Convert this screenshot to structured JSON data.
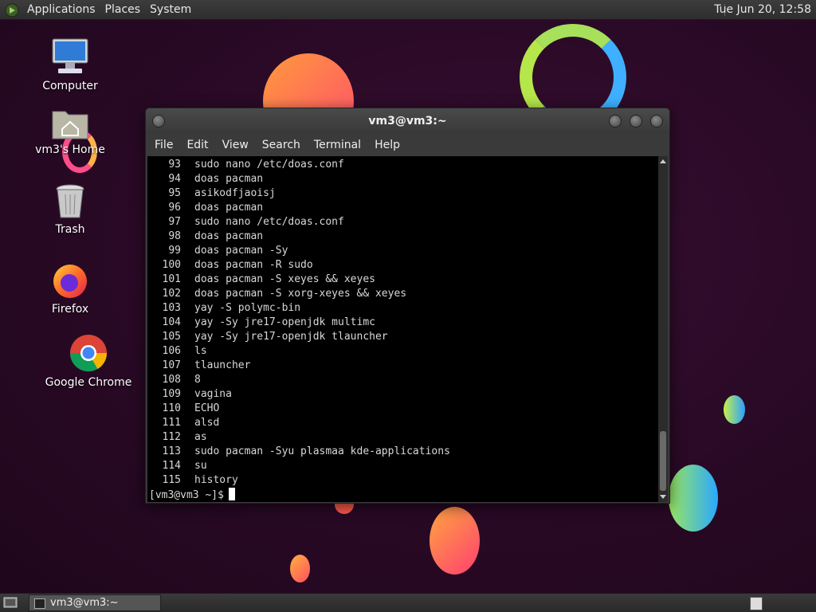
{
  "top_panel": {
    "menus": [
      "Applications",
      "Places",
      "System"
    ],
    "clock": "Tue Jun 20, 12:58"
  },
  "desktop_icons": [
    {
      "label": "Computer",
      "icon": "computer-icon"
    },
    {
      "label": "vm3's Home",
      "icon": "home-folder-icon"
    },
    {
      "label": "Trash",
      "icon": "trash-icon"
    },
    {
      "label": "Firefox",
      "icon": "firefox-icon"
    },
    {
      "label": "Google Chrome",
      "icon": "chrome-icon"
    }
  ],
  "terminal": {
    "title": "vm3@vm3:~",
    "menu": [
      "File",
      "Edit",
      "View",
      "Search",
      "Terminal",
      "Help"
    ],
    "history": [
      {
        "num": "93",
        "cmd": "sudo nano /etc/doas.conf"
      },
      {
        "num": "94",
        "cmd": "doas pacman"
      },
      {
        "num": "95",
        "cmd": "asikodfjaoisj"
      },
      {
        "num": "96",
        "cmd": "doas pacman"
      },
      {
        "num": "97",
        "cmd": "sudo nano /etc/doas.conf"
      },
      {
        "num": "98",
        "cmd": "doas pacman"
      },
      {
        "num": "99",
        "cmd": "doas pacman -Sy"
      },
      {
        "num": "100",
        "cmd": "doas pacman -R sudo"
      },
      {
        "num": "101",
        "cmd": "doas pacman -S xeyes && xeyes"
      },
      {
        "num": "102",
        "cmd": "doas pacman -S xorg-xeyes && xeyes"
      },
      {
        "num": "103",
        "cmd": "yay -S polymc-bin"
      },
      {
        "num": "104",
        "cmd": "yay -Sy jre17-openjdk multimc"
      },
      {
        "num": "105",
        "cmd": "yay -Sy jre17-openjdk tlauncher"
      },
      {
        "num": "106",
        "cmd": "ls"
      },
      {
        "num": "107",
        "cmd": "tlauncher"
      },
      {
        "num": "108",
        "cmd": "8"
      },
      {
        "num": "109",
        "cmd": "vagina"
      },
      {
        "num": "110",
        "cmd": "ECHO"
      },
      {
        "num": "111",
        "cmd": "alsd"
      },
      {
        "num": "112",
        "cmd": "as"
      },
      {
        "num": "113",
        "cmd": "sudo pacman -Syu plasmaa kde-applications"
      },
      {
        "num": "114",
        "cmd": "su"
      },
      {
        "num": "115",
        "cmd": "history"
      }
    ],
    "prompt": "[vm3@vm3 ~]$"
  },
  "taskbar": {
    "task_label": "vm3@vm3:~"
  },
  "colors": {
    "desktop_bg": "#2b0a27",
    "panel_bg": "#333333",
    "terminal_bg": "#000000",
    "terminal_fg": "#d8d8d8"
  }
}
